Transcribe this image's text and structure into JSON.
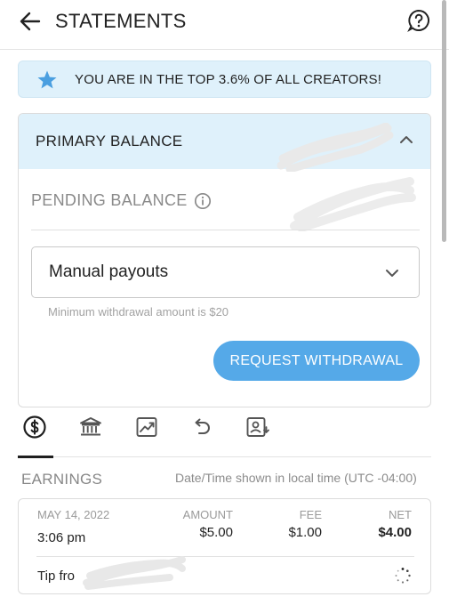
{
  "header": {
    "title": "STATEMENTS"
  },
  "banner": {
    "text": "YOU ARE IN THE TOP 3.6% OF ALL CREATORS!"
  },
  "balance_card": {
    "primary_label": "PRIMARY BALANCE",
    "pending_label": "PENDING BALANCE",
    "payout_select_value": "Manual payouts",
    "hint": "Minimum withdrawal amount is $20",
    "request_button": "REQUEST WITHDRAWAL"
  },
  "tabs": [
    {
      "icon": "dollar-circle-icon",
      "active": true
    },
    {
      "icon": "bank-icon",
      "active": false
    },
    {
      "icon": "trend-chart-icon",
      "active": false
    },
    {
      "icon": "undo-icon",
      "active": false
    },
    {
      "icon": "user-statement-icon",
      "active": false
    }
  ],
  "earnings": {
    "section_label": "EARNINGS",
    "tz_note": "Date/Time shown in local time (UTC -04:00)",
    "rows": [
      {
        "date": "MAY 14, 2022",
        "time": "3:06 pm",
        "amount_label": "AMOUNT",
        "amount": "$5.00",
        "fee_label": "FEE",
        "fee": "$1.00",
        "net_label": "NET",
        "net": "$4.00",
        "description": "Tip fro"
      }
    ]
  },
  "colors": {
    "accent": "#55a9e8",
    "banner_bg": "#dff1fb",
    "star": "#4a9fe0"
  }
}
